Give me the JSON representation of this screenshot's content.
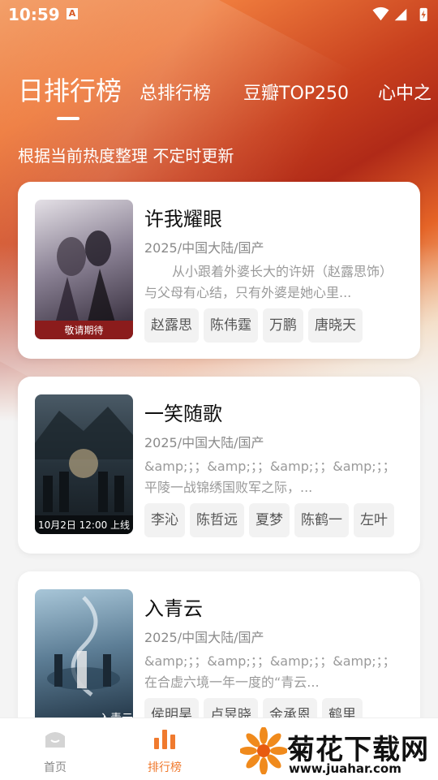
{
  "status": {
    "time": "10:59",
    "app_badge": "A"
  },
  "tabs": [
    "日排行榜",
    "总排行榜",
    "豆瓣TOP250",
    "心中之"
  ],
  "subtitle": "根据当前热度整理 不定时更新",
  "cards": [
    {
      "title": "许我耀眼",
      "meta": "2025/中国大陆/国产",
      "desc": "从小跟着外婆长大的许妍（赵露思饰）与父母有心结，只有外婆是她心里...",
      "cast": [
        "赵露思",
        "陈伟霆",
        "万鹏",
        "唐晓天"
      ],
      "poster_caption": "敬请期待",
      "poster_colors": [
        "#d8d4dc",
        "#6b6577",
        "#2b2330"
      ]
    },
    {
      "title": "一笑随歌",
      "meta": "2025/中国大陆/国产",
      "desc": "&amp;；；&amp;；；&amp;；；&amp;；；平陵一战锦绣国败军之际，...",
      "cast": [
        "李沁",
        "陈哲远",
        "夏梦",
        "陈鹤一",
        "左叶"
      ],
      "poster_caption": "10月2日 12:00 上线",
      "poster_colors": [
        "#3b4a55",
        "#22303a",
        "#1a2228"
      ]
    },
    {
      "title": "入青云",
      "meta": "2025/中国大陆/国产",
      "desc": "&amp;；；&amp;；；&amp;；；&amp;；；在合虚六境一年一度的“青云...",
      "cast": [
        "侯明昊",
        "卢昱晓",
        "金承恩",
        "鹤里"
      ],
      "poster_caption": "入青云",
      "poster_colors": [
        "#8db2c8",
        "#3f5f78",
        "#1d2e3c"
      ]
    }
  ],
  "nav": [
    {
      "label": "首页",
      "icon": "home-icon"
    },
    {
      "label": "排行榜",
      "icon": "chart-icon"
    }
  ],
  "watermark": {
    "text": "菊花下载网",
    "url": "www.juahar.com"
  },
  "colors": {
    "accent": "#f07a2e"
  }
}
